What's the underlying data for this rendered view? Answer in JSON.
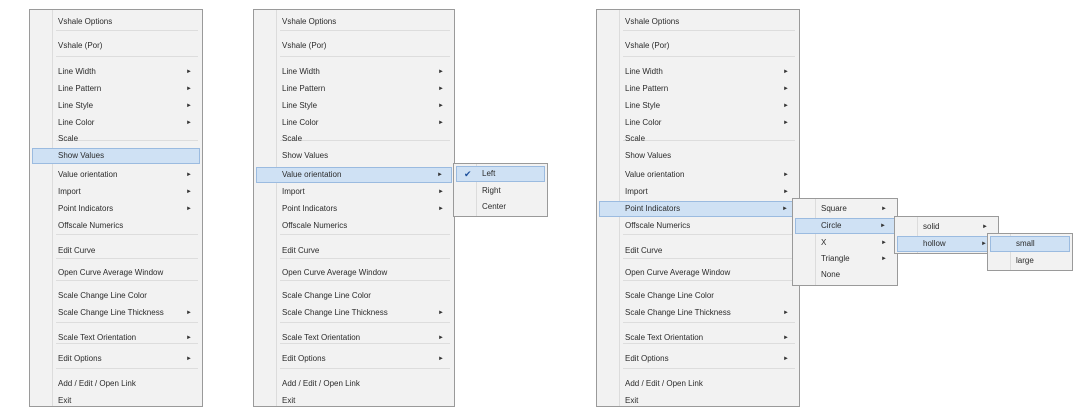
{
  "main_items": [
    {
      "label": "Vshale Options",
      "arrow": false
    },
    {
      "label": "Vshale (Por)",
      "arrow": false
    },
    {
      "label": "Line Width",
      "arrow": true
    },
    {
      "label": "Line Pattern",
      "arrow": true
    },
    {
      "label": "Line Style",
      "arrow": true
    },
    {
      "label": "Line Color",
      "arrow": true
    },
    {
      "label": "Scale",
      "arrow": false
    },
    {
      "label": "Show Values",
      "arrow": false
    },
    {
      "label": "Value orientation",
      "arrow": true
    },
    {
      "label": "Import",
      "arrow": true
    },
    {
      "label": "Point Indicators",
      "arrow": true
    },
    {
      "label": "Offscale Numerics",
      "arrow": false
    },
    {
      "label": "Edit Curve",
      "arrow": false
    },
    {
      "label": "Open Curve Average Window",
      "arrow": false
    },
    {
      "label": "Scale Change Line Color",
      "arrow": false
    },
    {
      "label": "Scale Change Line Thickness",
      "arrow": true
    },
    {
      "label": "Scale Text Orientation",
      "arrow": true
    },
    {
      "label": "Edit Options",
      "arrow": true
    },
    {
      "label": "Add / Edit / Open Link",
      "arrow": false
    },
    {
      "label": "Exit",
      "arrow": false
    }
  ],
  "arrow_glyph": "►",
  "orientation_submenu": {
    "items": [
      "Left",
      "Right",
      "Center"
    ],
    "checked_mark": "✔"
  },
  "point_indicators_submenu": [
    "Square",
    "Circle",
    "X",
    "Triangle",
    "None"
  ],
  "circle_submenu": [
    "solid",
    "hollow"
  ],
  "hollow_submenu": [
    "small",
    "large"
  ]
}
